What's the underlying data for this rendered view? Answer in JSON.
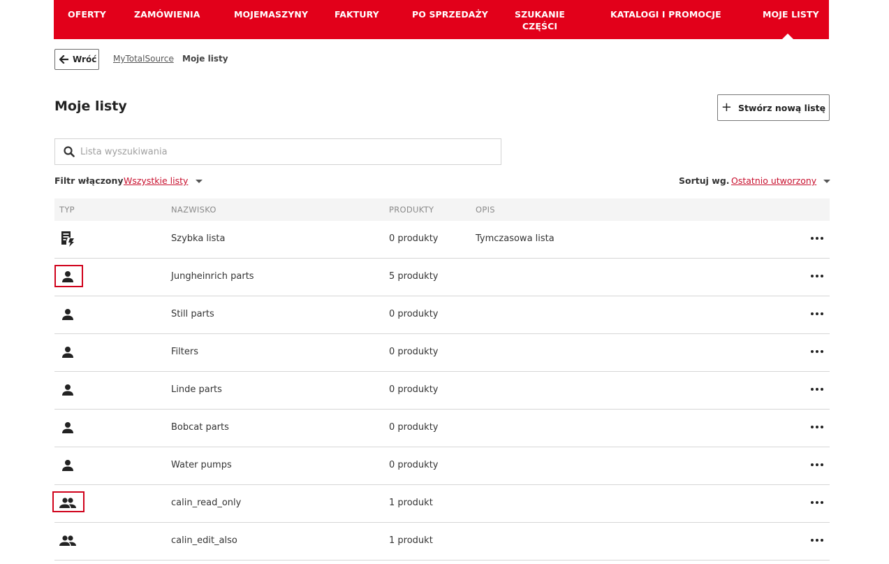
{
  "nav": {
    "items": [
      {
        "label": "OFERTY"
      },
      {
        "label": "ZAMÓWIENIA"
      },
      {
        "label": "MOJEMASZYNY"
      },
      {
        "label": "FAKTURY"
      },
      {
        "label": "PO SPRZEDAŻY"
      },
      {
        "label": "SZUKANIE\nCZĘŚCI"
      },
      {
        "label": "KATALOGI I PROMOCJE"
      },
      {
        "label": "MOJE LISTY"
      }
    ],
    "active": "MOJE LISTY"
  },
  "breadcrumb": {
    "back_label": "Wróć",
    "root": "MyTotalSource",
    "separator": "›",
    "current": "Moje listy"
  },
  "page": {
    "title": "Moje listy",
    "create_button": "Stwórz nową listę"
  },
  "search": {
    "placeholder": "Lista wyszukiwania",
    "value": ""
  },
  "filter": {
    "label": "Filtr włączony",
    "value": "Wszystkie listy"
  },
  "sort": {
    "label": "Sortuj wg.",
    "value": "Ostatnio utworzony"
  },
  "table": {
    "columns": [
      "TYP",
      "NAZWISKO",
      "PRODUKTY",
      "OPIS"
    ],
    "rows": [
      {
        "type": "quick-list-icon",
        "name": "Szybka lista",
        "products": "0 produkty",
        "description": "Tymczasowa lista",
        "highlighted": false
      },
      {
        "type": "person-icon",
        "name": "Jungheinrich parts",
        "products": "5 produkty",
        "description": "",
        "highlighted": true
      },
      {
        "type": "person-icon",
        "name": "Still parts",
        "products": "0 produkty",
        "description": "",
        "highlighted": false
      },
      {
        "type": "person-icon",
        "name": "Filters",
        "products": "0 produkty",
        "description": "",
        "highlighted": false
      },
      {
        "type": "person-icon",
        "name": "Linde parts",
        "products": "0 produkty",
        "description": "",
        "highlighted": false
      },
      {
        "type": "person-icon",
        "name": "Bobcat parts",
        "products": "0 produkty",
        "description": "",
        "highlighted": false
      },
      {
        "type": "person-icon",
        "name": "Water pumps",
        "products": "0 produkty",
        "description": "",
        "highlighted": false
      },
      {
        "type": "group-icon",
        "name": "calin_read_only",
        "products": "1 produkt",
        "description": "",
        "highlighted": true
      },
      {
        "type": "group-icon",
        "name": "calin_edit_also",
        "products": "1 produkt",
        "description": "",
        "highlighted": false
      }
    ]
  },
  "colors": {
    "brand_red": "#e2001a",
    "link_red": "#c8102e",
    "highlight_red": "#d0021b"
  }
}
